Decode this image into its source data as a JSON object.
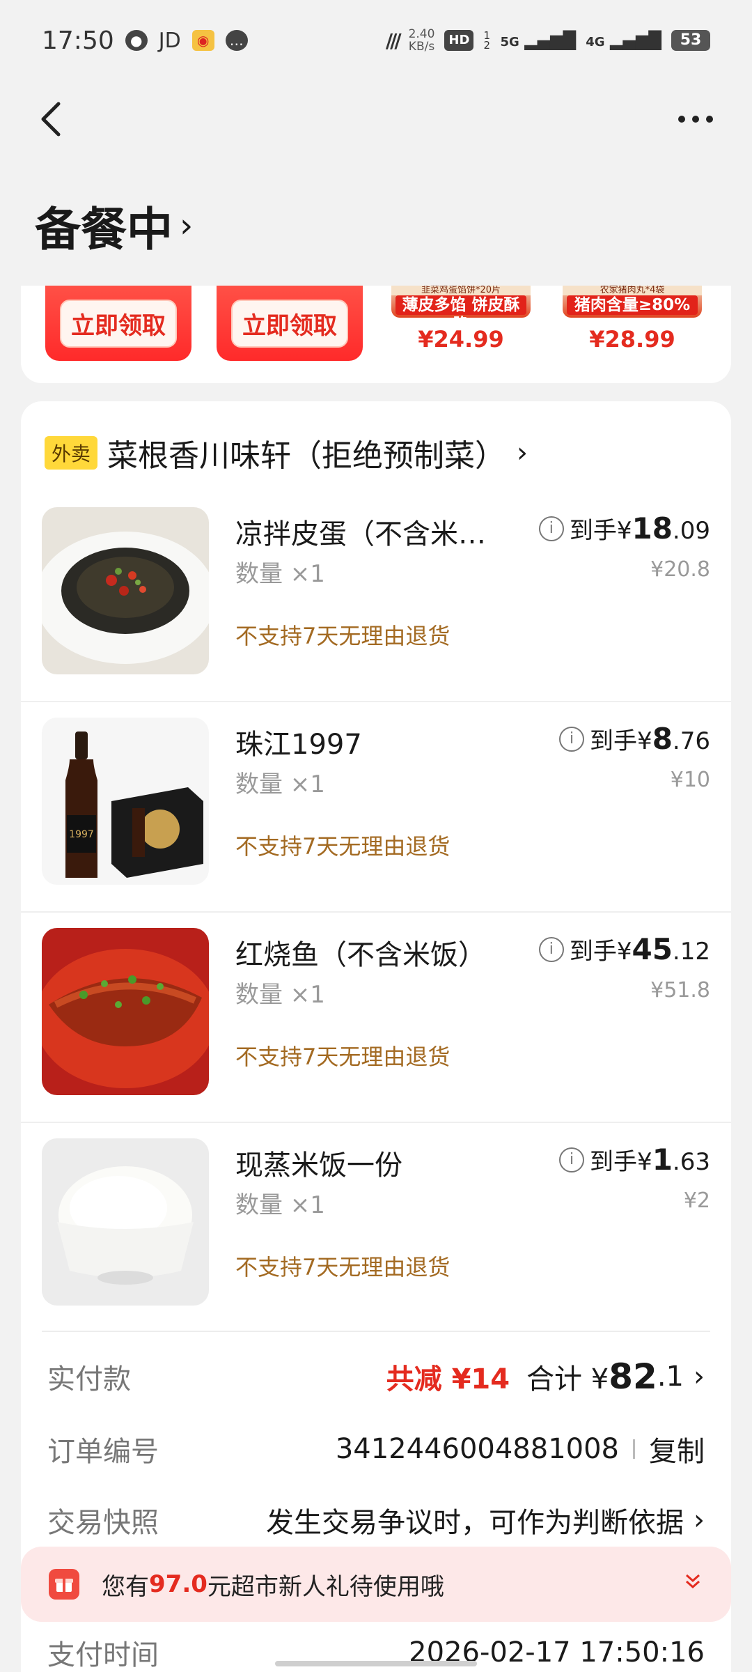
{
  "status_bar": {
    "time": "17:50",
    "app_icons": [
      "wechat-icon",
      "jd-icon",
      "weibo-icon",
      "message-icon"
    ],
    "jd_label": "JD",
    "net_speed_value": "2.40",
    "net_speed_unit": "KB/s",
    "hd_label": "HD",
    "hd_sub": "1 2",
    "signal_5g": "5G",
    "signal_4g": "4G",
    "battery": "53"
  },
  "header": {
    "order_status": "备餐中",
    "chevron": "›"
  },
  "coupons": {
    "buttons": [
      "立即领取",
      "立即领取"
    ],
    "promos": [
      {
        "caption": "韭菜鸡蛋馅饼*20片",
        "band": "薄皮多馅 饼皮酥脆",
        "price": "¥24.99"
      },
      {
        "caption": "农家猪肉丸*4袋",
        "band": "猪肉含量≥80%",
        "price": "¥28.99"
      }
    ]
  },
  "store": {
    "tag": "外卖",
    "name": "菜根香川味轩（拒绝预制菜）",
    "chevron": "›"
  },
  "items": [
    {
      "name": "凉拌皮蛋（不含米…",
      "qty": "数量 ×1",
      "policy": "不支持7天无理由退货",
      "price_prefix": "到手¥",
      "price_int": "18",
      "price_dec": ".09",
      "orig_price": "¥20.8"
    },
    {
      "name": "珠江1997",
      "qty": "数量 ×1",
      "policy": "不支持7天无理由退货",
      "price_prefix": "到手¥",
      "price_int": "8",
      "price_dec": ".76",
      "orig_price": "¥10"
    },
    {
      "name": "红烧鱼（不含米饭）",
      "qty": "数量 ×1",
      "policy": "不支持7天无理由退货",
      "price_prefix": "到手¥",
      "price_int": "45",
      "price_dec": ".12",
      "orig_price": "¥51.8"
    },
    {
      "name": "现蒸米饭一份",
      "qty": "数量 ×1",
      "policy": "不支持7天无理由退货",
      "price_prefix": "到手¥",
      "price_int": "1",
      "price_dec": ".63",
      "orig_price": "¥2"
    }
  ],
  "summary": {
    "paid_label": "实付款",
    "discount": "共减 ¥14",
    "total_prefix": "合计 ¥",
    "total_int": "82",
    "total_dec": ".1",
    "order_no_label": "订单编号",
    "order_no": "3412446004881008",
    "copy_label": "复制",
    "snapshot_label": "交易快照",
    "snapshot_text": "发生交易争议时，可作为判断依据",
    "pay_time_label": "支付时间",
    "pay_time": "2026-02-17 17:50:16",
    "chevron": "›"
  },
  "banner": {
    "pre": "您有",
    "amount": "97.0",
    "post": "元超市新人礼待使用哦",
    "fold_icon": "double-chevron-down-icon"
  },
  "colors": {
    "accent_red": "#e42b1f",
    "policy_brown": "#a36a22",
    "tag_yellow": "#ffd83a",
    "banner_bg": "#fde8e8"
  }
}
